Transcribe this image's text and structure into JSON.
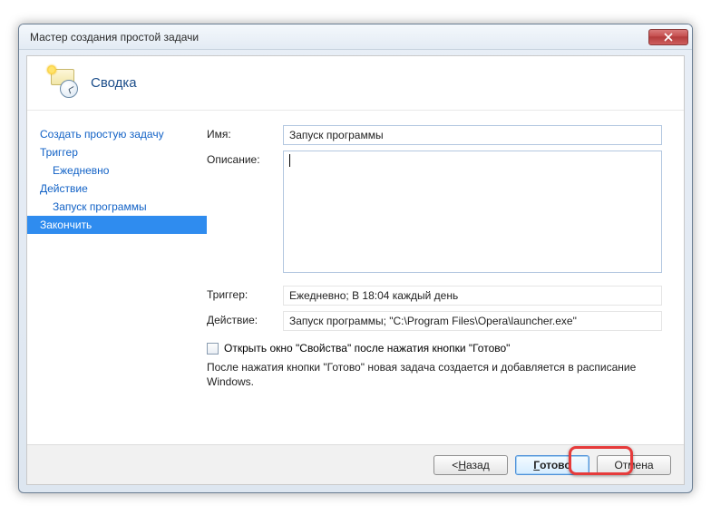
{
  "window": {
    "title": "Мастер создания простой задачи"
  },
  "header": {
    "title": "Сводка"
  },
  "sidebar": {
    "items": [
      {
        "label": "Создать простую задачу"
      },
      {
        "label": "Триггер"
      },
      {
        "label": "Ежедневно"
      },
      {
        "label": "Действие"
      },
      {
        "label": "Запуск программы"
      },
      {
        "label": "Закончить"
      }
    ]
  },
  "fields": {
    "name_label": "Имя:",
    "name_value": "Запуск программы",
    "desc_label": "Описание:",
    "desc_value": "",
    "trigger_label": "Триггер:",
    "trigger_value": "Ежедневно; В 18:04 каждый день",
    "action_label": "Действие:",
    "action_value": "Запуск программы; \"C:\\Program Files\\Opera\\launcher.exe\""
  },
  "checkbox": {
    "label": "Открыть окно \"Свойства\" после нажатия кнопки \"Готово\""
  },
  "hint": "После нажатия кнопки \"Готово\" новая задача создается и добавляется в расписание Windows.",
  "buttons": {
    "back_prefix": "< ",
    "back_u": "Н",
    "back_rest": "азад",
    "finish_u": "Г",
    "finish_rest": "отово",
    "cancel": "Отмена"
  }
}
